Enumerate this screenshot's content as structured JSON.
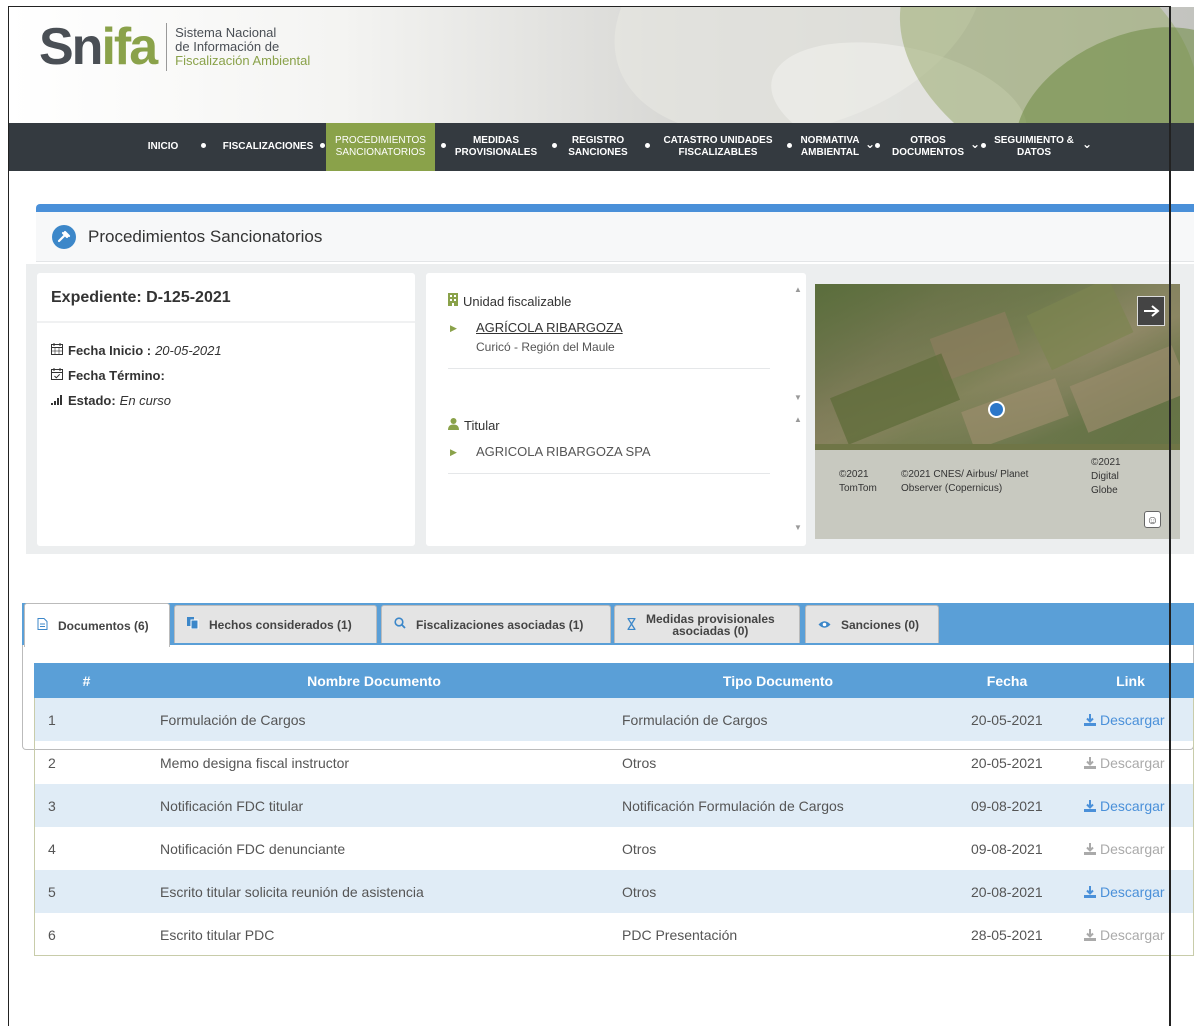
{
  "logo": {
    "word_1": "Sn",
    "word_2": "ifa",
    "line_1": "Sistema Nacional",
    "line_2": "de Información de",
    "line_3": "Fiscalización Ambiental"
  },
  "nav": {
    "items": [
      {
        "l1": "INICIO",
        "l2": ""
      },
      {
        "l1": "FISCALIZACIONES",
        "l2": ""
      },
      {
        "l1": "PROCEDIMIENTOS",
        "l2": "SANCIONATORIOS"
      },
      {
        "l1": "MEDIDAS",
        "l2": "PROVISIONALES"
      },
      {
        "l1": "REGISTRO",
        "l2": "SANCIONES"
      },
      {
        "l1": "CATASTRO UNIDADES",
        "l2": "FISCALIZABLES"
      },
      {
        "l1": "NORMATIVA",
        "l2": "AMBIENTAL"
      },
      {
        "l1": "OTROS",
        "l2": "DOCUMENTOS"
      },
      {
        "l1": "SEGUIMIENTO &",
        "l2": "DATOS"
      }
    ],
    "active_color": "#8aa24a",
    "bg_color": "#343a40"
  },
  "page_title": "Procedimientos Sancionatorios",
  "expediente": {
    "title": "Expediente: D-125-2021",
    "fecha_inicio_label": "Fecha Inicio :",
    "fecha_inicio_value": "20-05-2021",
    "fecha_termino_label": "Fecha Término:",
    "fecha_termino_value": "",
    "estado_label": "Estado:",
    "estado_value": "En curso"
  },
  "unidad": {
    "label": "Unidad fiscalizable",
    "name": "AGRÍCOLA RIBARGOZA",
    "location": "Curicó - Región del Maule",
    "titular_label": "Titular",
    "titular_name": "AGRICOLA RIBARGOZA SPA"
  },
  "map": {
    "attr_1a": "©2021",
    "attr_1b": "TomTom",
    "attr_2a": "©2021 CNES/ Airbus/ Planet",
    "attr_2b": "Observer (Copernicus)",
    "attr_3a": "©2021",
    "attr_3b": "Digital",
    "attr_3c": "Globe"
  },
  "tabs": [
    {
      "label": "Documentos (6)",
      "icon": "document-icon",
      "active": true
    },
    {
      "label": "Hechos considerados (1)",
      "icon": "copy-icon",
      "active": false
    },
    {
      "label": "Fiscalizaciones asociadas (1)",
      "icon": "search-icon",
      "active": false
    },
    {
      "label_1": "Medidas provisionales",
      "label_2": "asociadas (0)",
      "icon": "hourglass-icon",
      "active": false
    },
    {
      "label": "Sanciones (0)",
      "icon": "eye-icon",
      "active": false
    }
  ],
  "table": {
    "headers": [
      "#",
      "Nombre Documento",
      "Tipo Documento",
      "Fecha",
      "Link"
    ],
    "rows": [
      {
        "n": "1",
        "nombre": "Formulación de Cargos",
        "tipo": "Formulación de Cargos",
        "fecha": "20-05-2021",
        "link": "Descargar",
        "enabled": true
      },
      {
        "n": "2",
        "nombre": "Memo designa fiscal instructor",
        "tipo": "Otros",
        "fecha": "20-05-2021",
        "link": "Descargar",
        "enabled": false
      },
      {
        "n": "3",
        "nombre": "Notificación FDC titular",
        "tipo": "Notificación Formulación de Cargos",
        "fecha": "09-08-2021",
        "link": "Descargar",
        "enabled": true
      },
      {
        "n": "4",
        "nombre": "Notificación FDC denunciante",
        "tipo": "Otros",
        "fecha": "09-08-2021",
        "link": "Descargar",
        "enabled": false
      },
      {
        "n": "5",
        "nombre": "Escrito titular solicita reunión de asistencia",
        "tipo": "Otros",
        "fecha": "20-08-2021",
        "link": "Descargar",
        "enabled": true
      },
      {
        "n": "6",
        "nombre": "Escrito titular PDC",
        "tipo": "PDC Presentación",
        "fecha": "28-05-2021",
        "link": "Descargar",
        "enabled": false
      }
    ]
  }
}
